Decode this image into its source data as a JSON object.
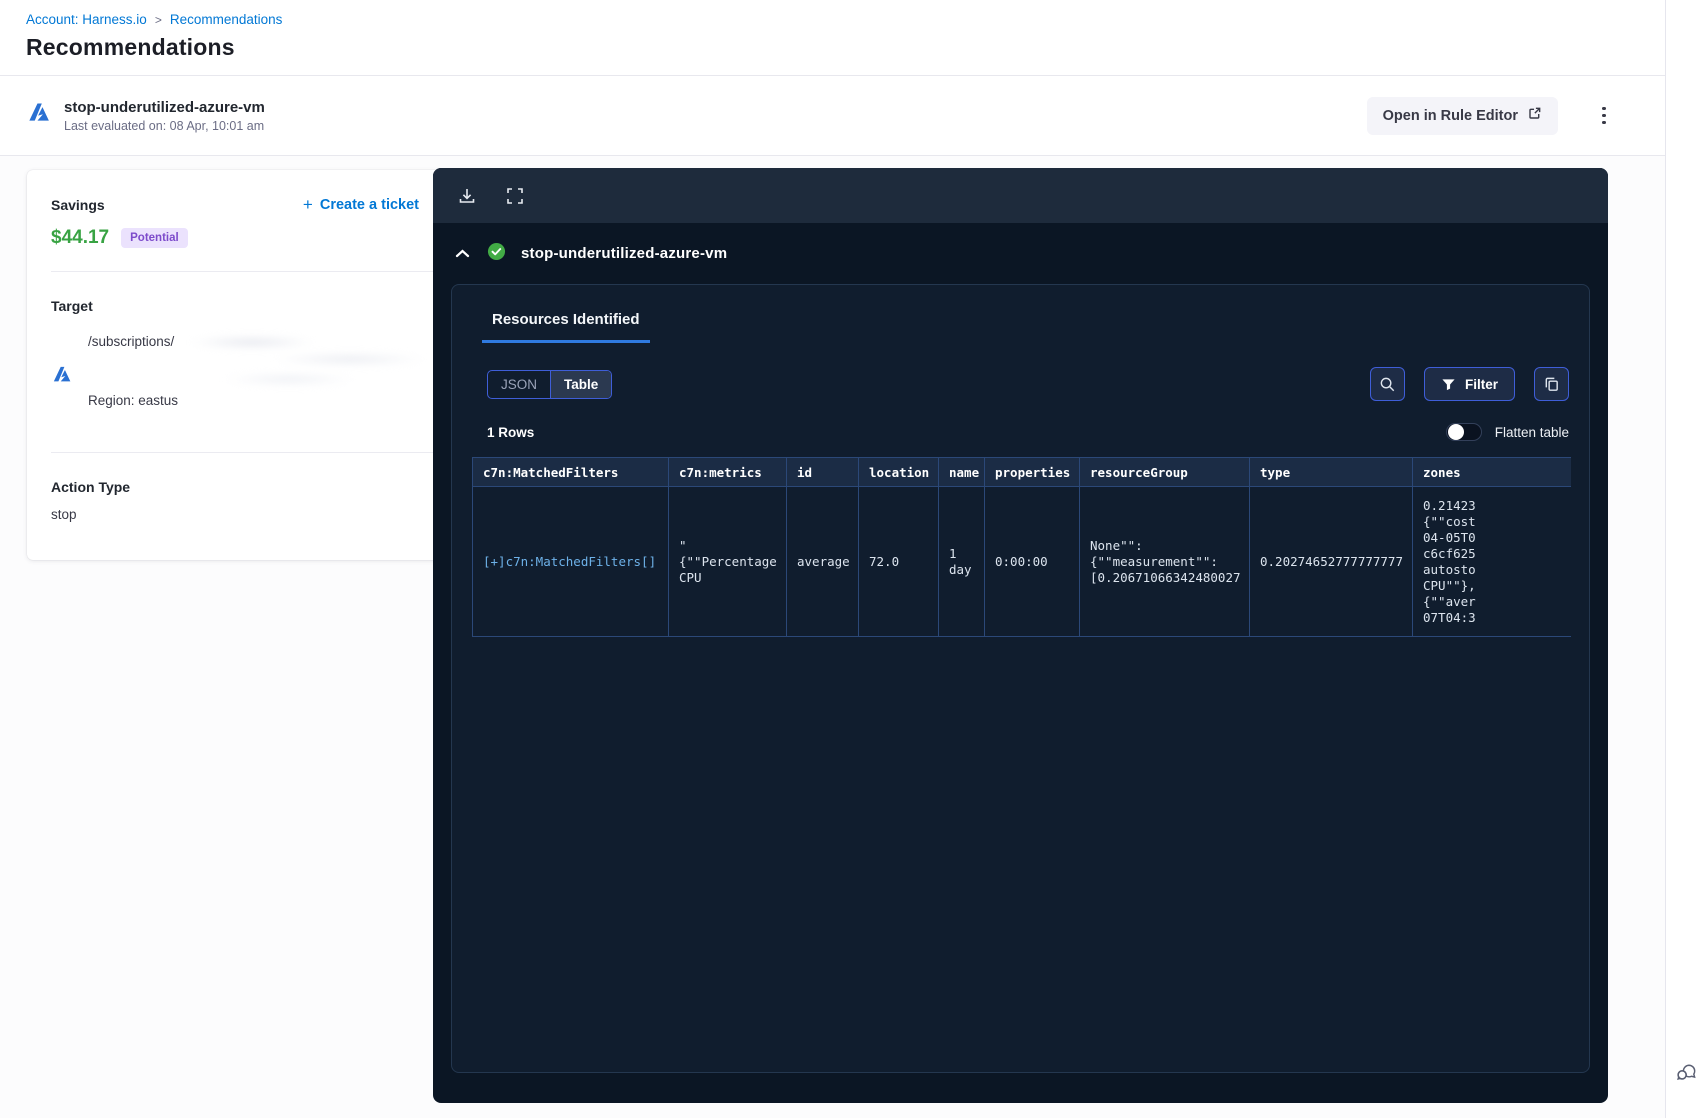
{
  "breadcrumb": {
    "account": "Account: Harness.io",
    "separator": ">",
    "page": "Recommendations"
  },
  "page_title": "Recommendations",
  "recommendation_header": {
    "name": "stop-underutilized-azure-vm",
    "last_evaluated": "Last evaluated on: 08 Apr, 10:01 am",
    "open_in_rule_editor": "Open in Rule Editor"
  },
  "details_card": {
    "savings_label": "Savings",
    "savings_value": "$44.17",
    "savings_badge": "Potential",
    "create_ticket_label": "Create a ticket",
    "create_ticket_plus": "+",
    "target_label": "Target",
    "target_path": "/subscriptions/",
    "target_region": "Region: eastus",
    "action_type_label": "Action Type",
    "action_type_value": "stop"
  },
  "results_panel": {
    "section_title": "stop-underutilized-azure-vm",
    "tab_label": "Resources Identified",
    "view_toggle": {
      "json_label": "JSON",
      "table_label": "Table",
      "selected": "Table"
    },
    "filter_label": "Filter",
    "rows_count": "1 Rows",
    "flatten_label": "Flatten table",
    "table": {
      "columns": [
        "c7n:MatchedFilters",
        "c7n:metrics",
        "id",
        "location",
        "name",
        "properties",
        "resourceGroup",
        "type",
        "zones"
      ],
      "rows": [
        [
          "[+]c7n:MatchedFilters[]",
          "\"\n{\"\"Percentage\nCPU",
          "average",
          "72.0",
          "1\nday",
          "0:00:00",
          "None\"\":\n{\"\"measurement\"\":\n[0.20671066342480027",
          "0.20274652777777777",
          "0.21423\n{\"\"cost\n04-05T0\nc6cf625\nautosto\nCPU\"\"},\n{\"\"aver\n07T04:3"
        ]
      ]
    }
  },
  "colors": {
    "accent_blue": "#0278d5",
    "savings_green": "#38a343",
    "badge_purple_text": "#7d4bcb",
    "badge_purple_bg": "#ebe2fd",
    "check_green": "#42ab45",
    "tab_underline": "#2f7ae0",
    "panel_button_border": "#3f5ed8",
    "table_grid_blue": "#2b4878",
    "panel_body": "#0b1624",
    "panel_toolbar": "#1e2b3c",
    "link_cell_blue": "#6db1e8"
  }
}
